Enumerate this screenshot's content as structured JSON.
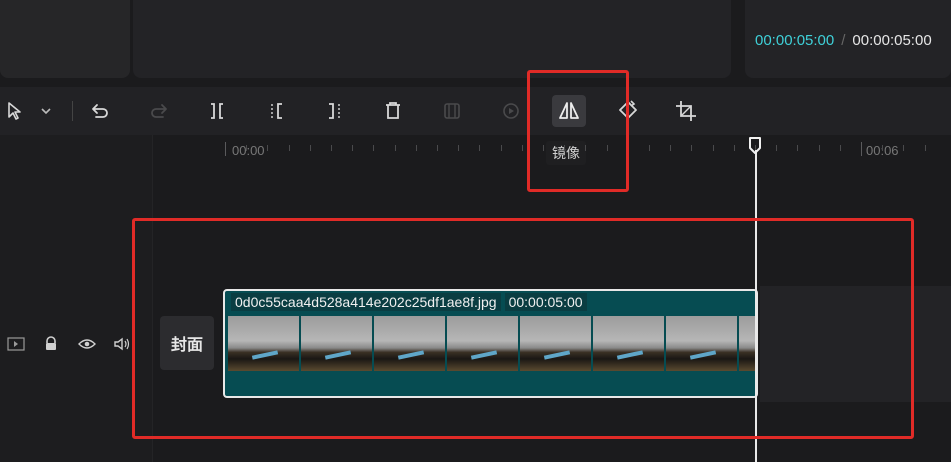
{
  "player": {
    "current_time": "00:00:05:00",
    "separator": "/",
    "total_time": "00:00:05:00"
  },
  "toolbar": {
    "tools": [
      {
        "name": "select-tool",
        "icon": "cursor-icon"
      },
      {
        "name": "select-dropdown",
        "icon": "chevron-down-icon"
      },
      {
        "name": "undo",
        "icon": "undo-icon"
      },
      {
        "name": "redo",
        "icon": "redo-icon",
        "disabled": true
      },
      {
        "name": "split",
        "icon": "split-icon"
      },
      {
        "name": "split-left",
        "icon": "split-left-icon"
      },
      {
        "name": "split-right",
        "icon": "split-right-icon"
      },
      {
        "name": "delete",
        "icon": "trash-icon"
      },
      {
        "name": "freeze",
        "icon": "freeze-icon",
        "disabled": true
      },
      {
        "name": "reverse",
        "icon": "reverse-icon",
        "disabled": true
      },
      {
        "name": "mirror",
        "icon": "mirror-icon",
        "active": true
      },
      {
        "name": "rotate",
        "icon": "rotate-icon"
      },
      {
        "name": "crop",
        "icon": "crop-icon"
      }
    ],
    "tooltip": "镜像"
  },
  "ruler": {
    "labels": [
      "00:00",
      "00:06"
    ]
  },
  "track": {
    "cover_label": "封面"
  },
  "clip": {
    "filename": "0d0c55caa4d528a414e202c25df1ae8f.jpg",
    "duration": "00:00:05:00",
    "thumbnail_count": 8
  },
  "colors": {
    "accent": "#3fd0d8",
    "clip_bg": "#064c52",
    "annotation": "#e12b27"
  }
}
